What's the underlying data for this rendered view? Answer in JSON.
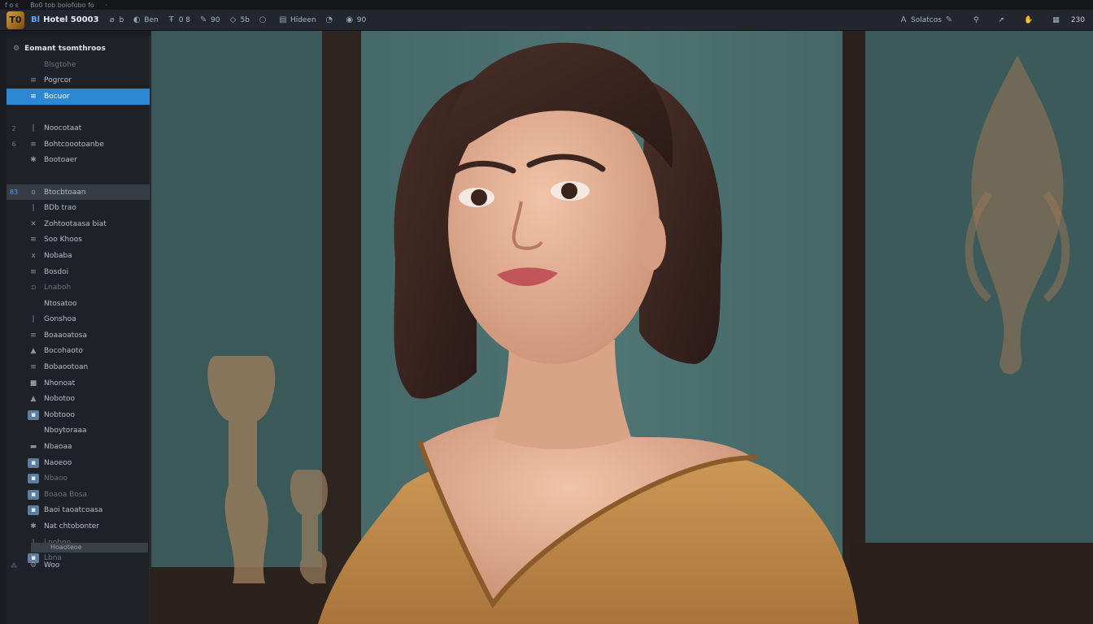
{
  "system_bar": {
    "items": [
      "f o ε",
      "Bo0 tob  bolofobo fo",
      "·"
    ]
  },
  "toolbar": {
    "logo": "T0",
    "accent_text": "Bl",
    "app_title": "Hotel 50003",
    "buttons": [
      {
        "icon": "b-icon",
        "label": "b"
      },
      {
        "icon": "circle-icon",
        "label": "Ben"
      },
      {
        "icon": "text-icon",
        "label": "0 8"
      },
      {
        "icon": "pen-icon",
        "label": "90"
      },
      {
        "icon": "shape-icon",
        "label": "5b"
      },
      {
        "icon": "circle-icon",
        "label": ""
      },
      {
        "icon": "layers-icon",
        "label": "Hideen"
      },
      {
        "icon": "refresh-icon",
        "label": ""
      },
      {
        "icon": "eye-icon",
        "label": "90"
      }
    ],
    "mode_icon": "A",
    "mode_label": "Solatcos",
    "right_icons": [
      "pin-icon",
      "arrow-icon",
      "hand-icon",
      "grid-icon"
    ],
    "zoom": "230"
  },
  "sidebar": {
    "title": "Eomant tsomthroos",
    "items": [
      {
        "num": "",
        "icon": "",
        "label": "Blsgtohe",
        "state": "dim"
      },
      {
        "num": "",
        "icon": "≡",
        "label": "Pogrcor",
        "state": ""
      },
      {
        "num": "",
        "icon": "≡",
        "label": "Bocuor",
        "state": "active"
      },
      {
        "num": "",
        "icon": "",
        "label": "",
        "state": ""
      },
      {
        "num": "2",
        "icon": "|",
        "label": "Noocotaat",
        "state": ""
      },
      {
        "num": "6",
        "icon": "≡",
        "label": "Bohtcoootoanbe",
        "state": ""
      },
      {
        "num": "",
        "icon": "✱",
        "label": "Bootoaer",
        "state": ""
      },
      {
        "num": "",
        "icon": "",
        "label": "",
        "state": ""
      },
      {
        "num": "83",
        "icon": "o",
        "label": "Btocbtoaan",
        "state": "hl"
      },
      {
        "num": "",
        "icon": "|",
        "label": "BDb trao",
        "state": ""
      },
      {
        "num": "",
        "icon": "✕",
        "label": "Zohtootaasa biat",
        "state": ""
      },
      {
        "num": "",
        "icon": "≡",
        "label": "Soo Khoos",
        "state": ""
      },
      {
        "num": "",
        "icon": "x",
        "label": "Nobaba",
        "state": ""
      },
      {
        "num": "",
        "icon": "≡",
        "label": "Bosdoi",
        "state": ""
      },
      {
        "num": "",
        "icon": "▫",
        "label": "Lnaboh",
        "state": "dim"
      },
      {
        "num": "",
        "icon": "",
        "label": "Ntosatoo",
        "state": ""
      },
      {
        "num": "",
        "icon": "|",
        "label": "Gonshoa",
        "state": ""
      },
      {
        "num": "",
        "icon": "≡",
        "label": "Boaaoatosa",
        "state": ""
      },
      {
        "num": "",
        "icon": "▲",
        "label": "Bocohaoto",
        "state": ""
      },
      {
        "num": "",
        "icon": "≡",
        "label": "Bobaootoan",
        "state": ""
      },
      {
        "num": "",
        "icon": "■",
        "label": "Nhonoat",
        "state": ""
      },
      {
        "num": "",
        "icon": "▲",
        "label": "Nobotoo",
        "state": ""
      },
      {
        "num": "",
        "icon": "▪",
        "label": "Nobtooo",
        "state": "thumb"
      },
      {
        "num": "",
        "icon": "",
        "label": "Nboytoraaa",
        "state": ""
      },
      {
        "num": "",
        "icon": "▬",
        "label": "Nbaoaa",
        "state": ""
      },
      {
        "num": "",
        "icon": "▪",
        "label": "Naoeoo",
        "state": "thumb"
      },
      {
        "num": "",
        "icon": "▪",
        "label": "Nbaoo",
        "state": "thumb dim"
      },
      {
        "num": "",
        "icon": "▪",
        "label": "Boaoa Bosa",
        "state": "thumb dim"
      },
      {
        "num": "",
        "icon": "▪",
        "label": "Baoi taoatcoasa",
        "state": "thumb"
      },
      {
        "num": "",
        "icon": "✱",
        "label": "Nat chtobonter",
        "state": ""
      },
      {
        "num": "",
        "icon": "|",
        "label": "Lnoboo",
        "state": "dim"
      },
      {
        "num": "",
        "icon": "▪",
        "label": "Lbna",
        "state": "thumb dim"
      }
    ],
    "footer_label": "Hoaoteoe",
    "footer_item": "Woo"
  },
  "colors": {
    "accent": "#2d88d4",
    "toolbar_bg": "#23272d",
    "sidebar_bg": "#1e2227",
    "wall": "#3d5c5b",
    "blouse": "#c08d4a",
    "hair": "#3a2520"
  }
}
